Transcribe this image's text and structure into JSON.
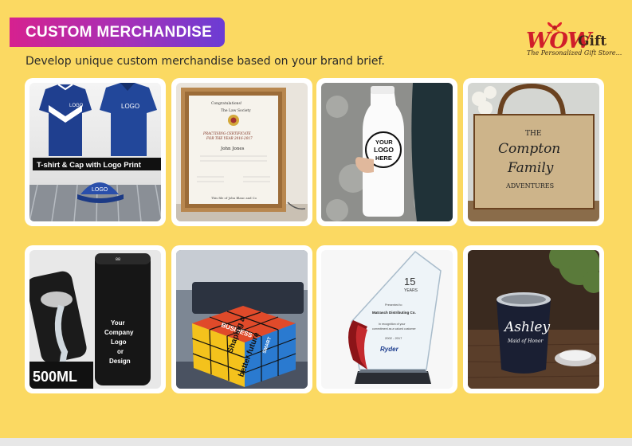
{
  "header": {
    "title": "CUSTOM MERCHANDISE",
    "subtitle": "Develop unique custom merchandise based on your brand brief."
  },
  "brand": {
    "wow": "WOW",
    "gift": "Gift",
    "tagline": "The Personalized Gift Store..."
  },
  "products": {
    "tshirt": {
      "caption": "T-shirt & Cap with Logo Print",
      "shirt_logo": "LOGO",
      "cap_logo": "LOGO",
      "chest_logo": "LOGO"
    },
    "certificate": {
      "top_text": "Congratulations!",
      "society": "The Law Society",
      "heading_1": "PRACTISING CERTIFICATE",
      "heading_2": "FOR THE YEAR 2016-2017",
      "name": "John Jones",
      "footer": "This file of John Blanc and Co"
    },
    "bottle": {
      "badge_1": "YOUR",
      "badge_2": "LOGO",
      "badge_3": "HERE"
    },
    "tote": {
      "line_1": "THE",
      "line_2": "Compton",
      "line_3": "Family",
      "line_4": "ADVENTURES"
    },
    "flask": {
      "label_1": "Your",
      "label_2": "Company",
      "label_3": "Logo",
      "label_4": "or",
      "label_5": "Design",
      "volume": "500ML"
    },
    "cube": {
      "text_1": "BUSINESS",
      "text_2": "Shaping a",
      "text_3": "better future",
      "text_4": "SMART"
    },
    "award": {
      "number": "15",
      "years": "YEARS",
      "presented": "Presented to",
      "company": "Matrasch Distributing Co.",
      "recognition": "In recognition of your",
      "recognition_2": "commitment as a valued customer",
      "dates": "2002 - 2017",
      "brand": "Ryder"
    },
    "tumbler": {
      "name": "Ashley",
      "role": "Maid of Honor"
    }
  },
  "colors": {
    "background": "#fbd962",
    "banner_start": "#d6218f",
    "banner_end": "#6b3cd4",
    "brand_red": "#d01e2a"
  }
}
